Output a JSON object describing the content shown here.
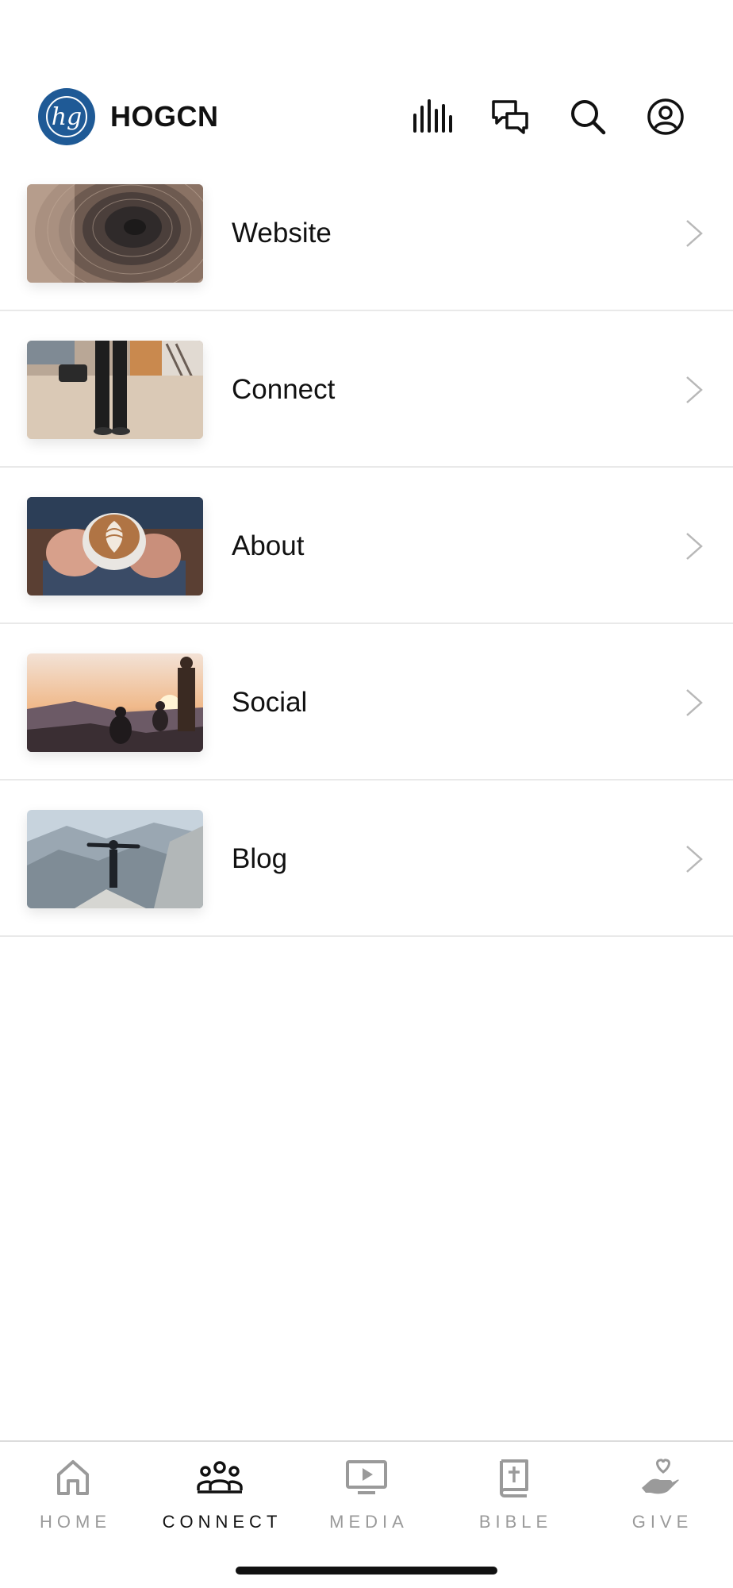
{
  "app": {
    "title": "HOGCN",
    "logo_text": "hg",
    "brand_color": "#1f5a96"
  },
  "header_icons": [
    "audio-bars-icon",
    "chat-icon",
    "search-icon",
    "account-icon"
  ],
  "rows": [
    {
      "label": "Website",
      "thumbnail": "tree-rings-photo"
    },
    {
      "label": "Connect",
      "thumbnail": "beach-walk-photo"
    },
    {
      "label": "About",
      "thumbnail": "latte-cup-photo"
    },
    {
      "label": "Social",
      "thumbnail": "sunset-friends-photo"
    },
    {
      "label": "Blog",
      "thumbnail": "mountain-peak-photo"
    }
  ],
  "tabs": [
    {
      "label": "HOME",
      "icon": "home-icon",
      "active": false
    },
    {
      "label": "CONNECT",
      "icon": "people-icon",
      "active": true
    },
    {
      "label": "MEDIA",
      "icon": "play-screen-icon",
      "active": false
    },
    {
      "label": "BIBLE",
      "icon": "bible-icon",
      "active": false
    },
    {
      "label": "GIVE",
      "icon": "hand-heart-icon",
      "active": false
    }
  ],
  "colors": {
    "active_tab": "#111111",
    "inactive_tab": "#9a9a9a",
    "divider": "#e9e9e9"
  }
}
